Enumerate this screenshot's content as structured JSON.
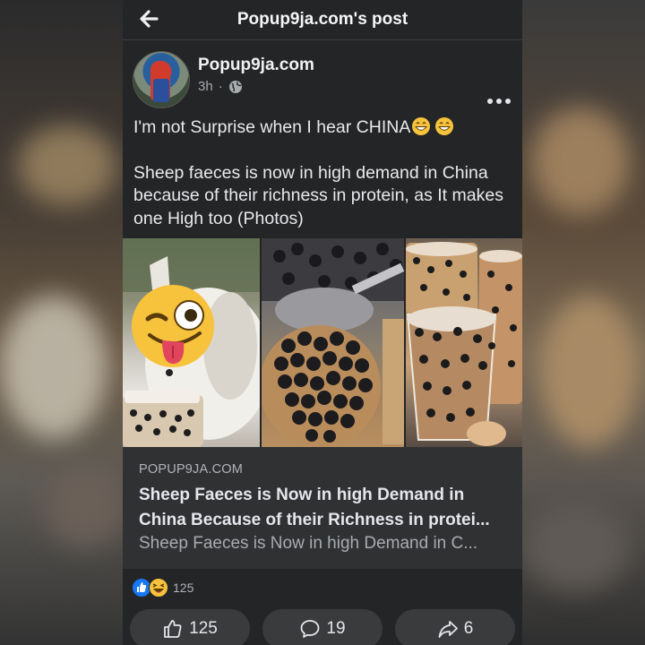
{
  "topbar": {
    "title": "Popup9ja.com's post"
  },
  "post": {
    "author": "Popup9ja.com",
    "time": "3h",
    "separator": "·",
    "text_line1": "I'm not Surprise when I hear CHINA",
    "text_paragraph2": "Sheep faeces is now in high demand in China because of their richness in protein, as It makes one High too (Photos)"
  },
  "link": {
    "domain": "POPUP9JA.COM",
    "title_line1": "Sheep Faeces is Now in high Demand in",
    "title_line2": "China Because of their Richness in protei...",
    "description": "Sheep Faeces is Now in high Demand in C..."
  },
  "reactions": {
    "count": "125"
  },
  "actions": {
    "like_count": "125",
    "comment_count": "19",
    "share_count": "6"
  },
  "colors": {
    "background": "#242526",
    "link_card": "#303133",
    "like_blue": "#1877f2",
    "haha_yellow": "#f7c33d"
  },
  "icons": [
    "back-arrow-icon",
    "globe-icon",
    "more-icon",
    "grinning-emoji-icon",
    "winking-tongue-emoji",
    "like-reaction-icon",
    "haha-reaction-icon",
    "thumbs-up-icon",
    "comment-icon",
    "share-icon"
  ]
}
